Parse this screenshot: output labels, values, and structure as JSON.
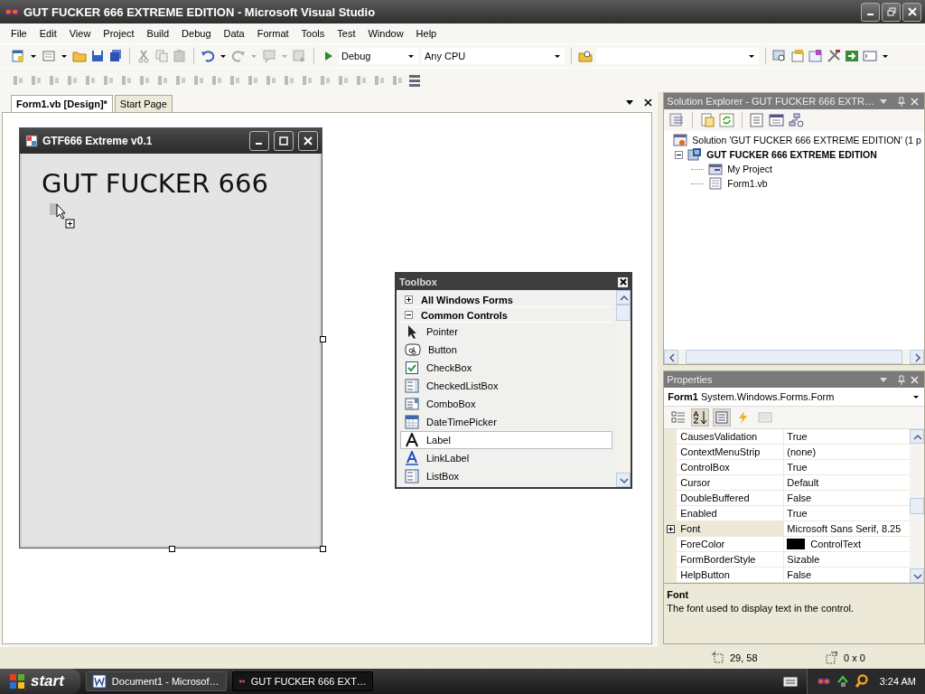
{
  "window": {
    "title": "GUT FUCKER 666 EXTREME EDITION - Microsoft Visual Studio"
  },
  "menu": [
    "File",
    "Edit",
    "View",
    "Project",
    "Build",
    "Debug",
    "Data",
    "Format",
    "Tools",
    "Test",
    "Window",
    "Help"
  ],
  "toolbar": {
    "configuration": "Debug",
    "platform": "Any CPU"
  },
  "tabs": [
    {
      "label": "Form1.vb [Design]*",
      "selected": true
    },
    {
      "label": "Start Page",
      "selected": false
    }
  ],
  "form": {
    "title": "GTF666 Extreme v0.1",
    "label": "GUT FUCKER 666"
  },
  "toolbox": {
    "title": "Toolbox",
    "items": [
      {
        "kind": "group",
        "label": "All Windows Forms",
        "expanded": false,
        "selected": false
      },
      {
        "kind": "group",
        "label": "Common Controls",
        "expanded": true,
        "selected": false
      },
      {
        "kind": "pointer",
        "label": "Pointer",
        "selected": false
      },
      {
        "kind": "button",
        "label": "Button",
        "selected": false
      },
      {
        "kind": "checkbox",
        "label": "CheckBox",
        "selected": false
      },
      {
        "kind": "list",
        "label": "CheckedListBox",
        "selected": false
      },
      {
        "kind": "combo",
        "label": "ComboBox",
        "selected": false
      },
      {
        "kind": "date",
        "label": "DateTimePicker",
        "selected": false
      },
      {
        "kind": "label",
        "label": "Label",
        "selected": true
      },
      {
        "kind": "link",
        "label": "LinkLabel",
        "selected": false
      },
      {
        "kind": "list",
        "label": "ListBox",
        "selected": false
      }
    ]
  },
  "solution_explorer": {
    "title": "Solution Explorer - GUT FUCKER 666 EXTR…",
    "tree": [
      {
        "kind": "solution",
        "label": "Solution 'GUT FUCKER 666 EXTREME EDITION' (1 p",
        "children": [
          {
            "kind": "project",
            "label": "GUT FUCKER 666 EXTREME EDITION",
            "expanded": true,
            "children": [
              {
                "kind": "settings",
                "label": "My Project"
              },
              {
                "kind": "form",
                "label": "Form1.vb"
              }
            ]
          }
        ]
      }
    ]
  },
  "properties": {
    "title": "Properties",
    "object_name": "Form1",
    "object_type": "System.Windows.Forms.Form",
    "view_buttons": [
      {
        "kind": "categorized",
        "selected": false
      },
      {
        "kind": "alphabetical",
        "selected": true
      },
      {
        "kind": "properties",
        "selected": true
      },
      {
        "kind": "events",
        "selected": false
      },
      {
        "kind": "pages",
        "selected": false
      }
    ],
    "rows": [
      {
        "name": "CausesValidation",
        "value": "True",
        "expandable": false,
        "selected": false
      },
      {
        "name": "ContextMenuStrip",
        "value": "(none)",
        "expandable": false,
        "selected": false
      },
      {
        "name": "ControlBox",
        "value": "True",
        "expandable": false,
        "selected": false
      },
      {
        "name": "Cursor",
        "value": "Default",
        "expandable": false,
        "selected": false
      },
      {
        "name": "DoubleBuffered",
        "value": "False",
        "expandable": false,
        "selected": false
      },
      {
        "name": "Enabled",
        "value": "True",
        "expandable": false,
        "selected": false
      },
      {
        "name": "Font",
        "value": "Microsoft Sans Serif, 8.25",
        "expandable": true,
        "selected": true
      },
      {
        "name": "ForeColor",
        "value": "ControlText",
        "expandable": false,
        "selected": false,
        "color": "#000000"
      },
      {
        "name": "FormBorderStyle",
        "value": "Sizable",
        "expandable": false,
        "selected": false
      },
      {
        "name": "HelpButton",
        "value": "False",
        "expandable": false,
        "selected": false
      }
    ],
    "description": {
      "title": "Font",
      "text": "The font used to display text in the control."
    }
  },
  "status_bar": {
    "position": "29, 58",
    "size": "0 x 0"
  },
  "taskbar": {
    "start": "start",
    "tasks": [
      {
        "label": "Document1 - Microsof…",
        "selected": false
      },
      {
        "label": "GUT FUCKER 666 EXT…",
        "selected": true
      }
    ],
    "clock": "3:24 AM"
  }
}
